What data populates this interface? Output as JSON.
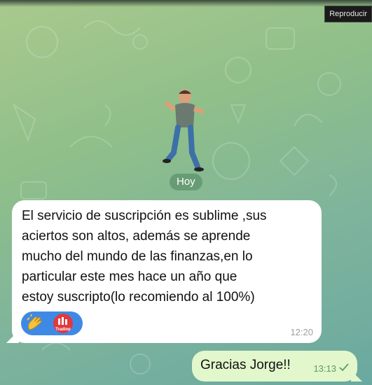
{
  "overlay": {
    "replay_label": "Reproducir"
  },
  "chat": {
    "date_badge": "Hoy",
    "incoming": {
      "text": "El servicio de suscripción es sublime ,sus\naciertos son altos, además se aprende\nmucho del mundo de las finanzas,en lo\nparticular este mes hace un año que\nestoy suscripto(lo recomiendo al 100%)",
      "time": "12:20",
      "reaction": {
        "emoji": "clapping-hands-icon",
        "avatar_label": "Trading"
      }
    },
    "outgoing": {
      "text": "Gracias Jorge!!",
      "time": "13:13",
      "status_icon": "single-check-icon"
    }
  },
  "colors": {
    "incoming_bubble": "#ffffff",
    "outgoing_bubble": "#e2f7cc",
    "reaction_pill": "#3f89e6",
    "badge_bg": "#61966e"
  }
}
